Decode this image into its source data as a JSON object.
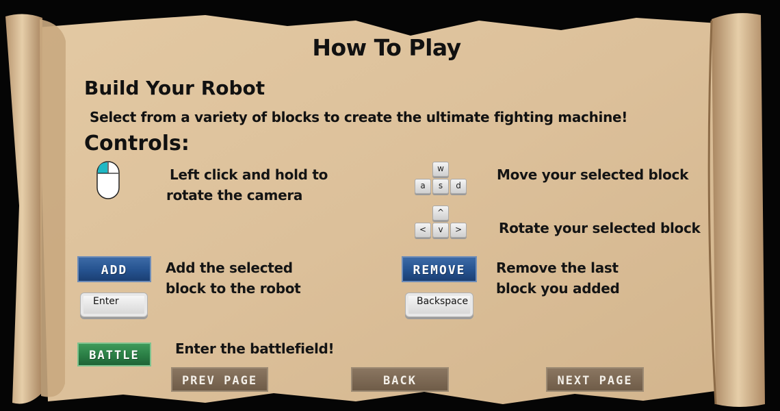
{
  "page": {
    "title": "How To Play"
  },
  "build": {
    "heading": "Build Your Robot",
    "description": "Select from a variety of blocks to create the ultimate fighting machine!"
  },
  "controls": {
    "heading": "Controls:",
    "mouse": {
      "icon": "mouse-left-click-icon",
      "line1": "Left click and hold to",
      "line2": "rotate the camera"
    },
    "move": {
      "keys": [
        "w",
        "a",
        "s",
        "d"
      ],
      "text": "Move your selected block"
    },
    "rotate": {
      "keys": [
        "^",
        "<",
        "v",
        ">"
      ],
      "text": "Rotate your selected block"
    },
    "add": {
      "button_label": "ADD",
      "key_label": "Enter",
      "line1": "Add the selected",
      "line2": "block to the robot"
    },
    "remove": {
      "button_label": "REMOVE",
      "key_label": "Backspace",
      "line1": "Remove the last",
      "line2": "block you added"
    },
    "battle": {
      "button_label": "BATTLE",
      "text": "Enter the battlefield!"
    }
  },
  "nav": {
    "prev_label": "PREV PAGE",
    "back_label": "BACK",
    "next_label": "NEXT PAGE"
  },
  "colors": {
    "parchment": "#dcc19c",
    "blue_button": "#25528f",
    "green_button": "#2a7e45",
    "brown_button": "#6f5c48",
    "mouse_accent": "#1fb8c4"
  }
}
